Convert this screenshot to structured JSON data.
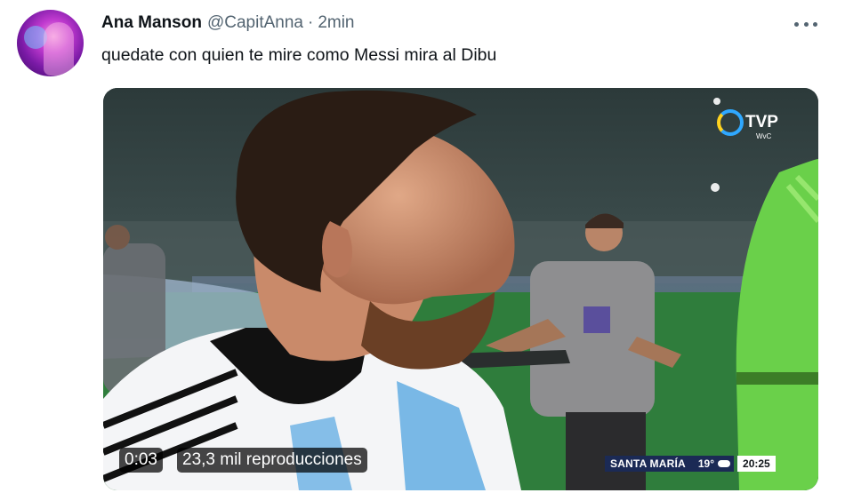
{
  "tweet": {
    "author_name": "Ana Manson",
    "handle": "@CapitAnna",
    "separator": "·",
    "time_ago": "2min",
    "text": "quedate con quien te mire como Messi mira al Dibu"
  },
  "video": {
    "broadcaster_logo": "TVP",
    "broadcaster_sub": "WvC",
    "elapsed": "0:03",
    "views": "23,3 mil reproducciones",
    "lower_third": {
      "city": "SANTA MARÍA",
      "temperature": "19°",
      "weather_icon": "cloud-icon",
      "clock": "20:25"
    }
  },
  "icons": {
    "more": "more-options-icon"
  },
  "colors": {
    "text_primary": "#0f1419",
    "text_secondary": "#536471",
    "accent_logo": "#2fa8ff"
  }
}
